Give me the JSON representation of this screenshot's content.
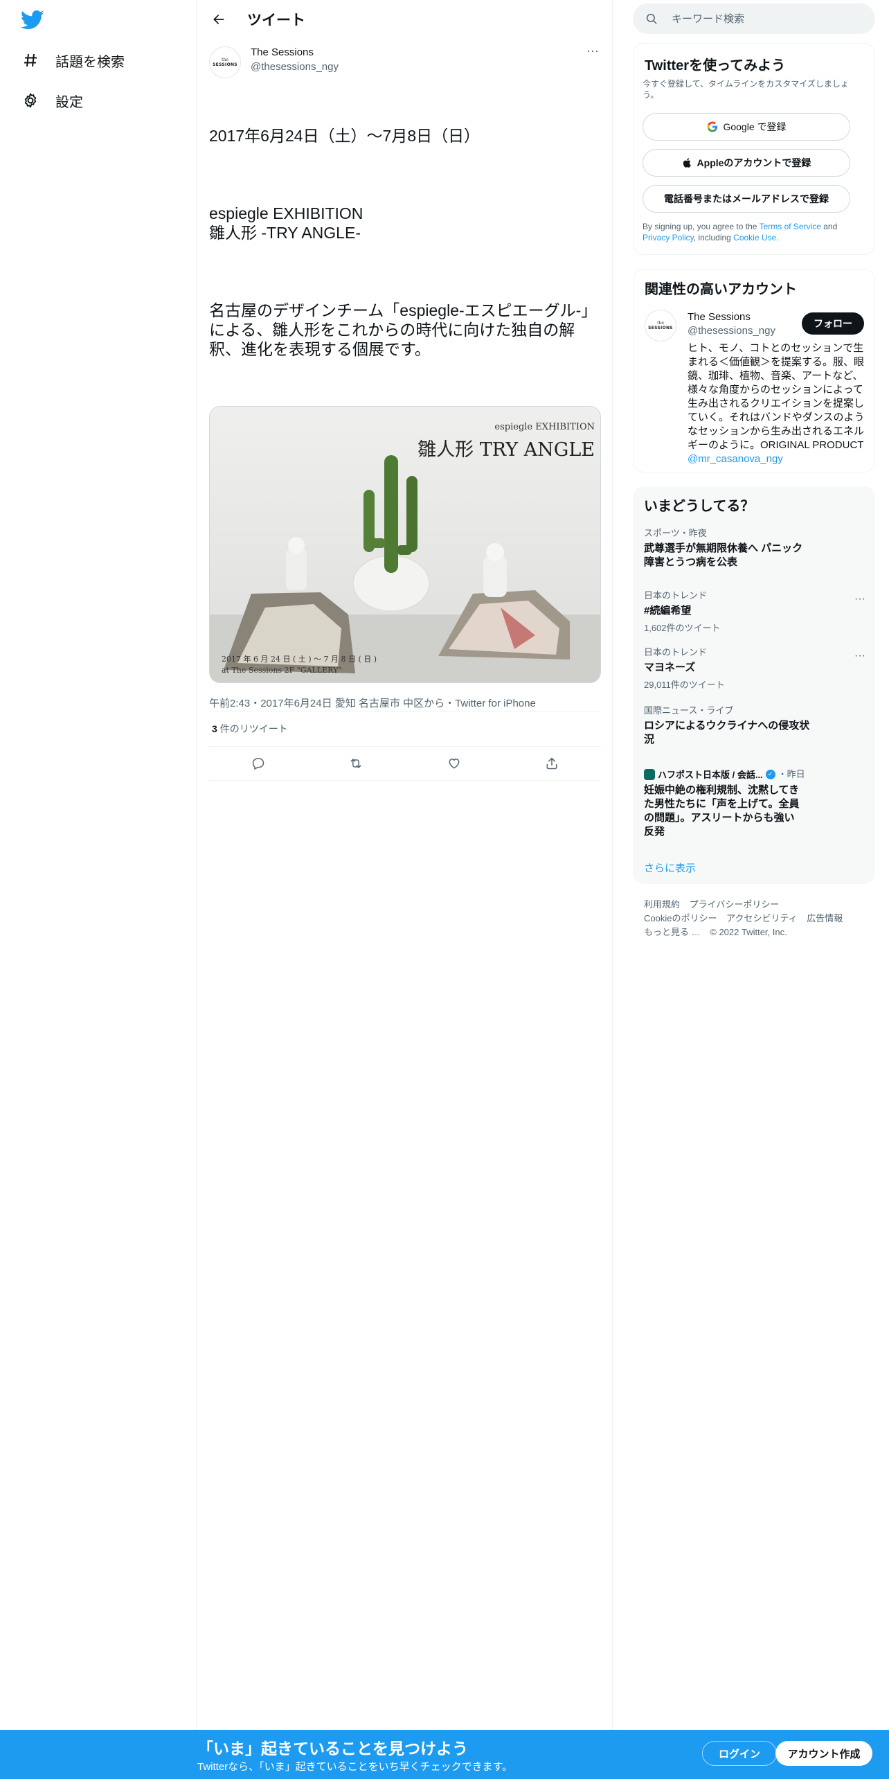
{
  "nav": {
    "items": [
      {
        "label": "話題を検索",
        "icon": "hashtag-icon"
      },
      {
        "label": "設定",
        "icon": "gear-icon"
      }
    ]
  },
  "header": {
    "title": "ツイート"
  },
  "tweet": {
    "author_name": "The Sessions",
    "author_handle": "@thesessions_ngy",
    "avatar_top": "the",
    "avatar_name": "SESSIONS",
    "paragraphs": [
      "2017年6月24日（土）～7月8日（日）",
      "espiegle EXHIBITION\n雛人形 -TRY ANGLE-",
      "名古屋のデザインチーム「espiegle-エスピエーグル-」による、雛人形をこれからの時代に向けた独自の解釈、進化を表現する個展です。"
    ],
    "image_text": {
      "top_small": "espiegle EXHIBITION",
      "top_big": "雛人形 TRY ANGLE",
      "bottom1": "2017 年 6 月 24 日 ( 土 ) ～ 7 月 8 日 ( 日 )",
      "bottom2": "at The Sessions 2F \"GALLERY\""
    },
    "meta": "午前2:43・2017年6月24日 愛知 名古屋市 中区から・Twitter for iPhone",
    "retweet_count": "3",
    "retweet_label": "件のリツイート"
  },
  "search": {
    "placeholder": "キーワード検索"
  },
  "signup_card": {
    "title": "Twitterを使ってみよう",
    "subtitle": "今すぐ登録して、タイムラインをカスタマイズしましょう。",
    "google_label": "Google で登録",
    "apple_label": "Appleのアカウントで登録",
    "phone_label": "電話番号またはメールアドレスで登録",
    "legal_prefix": "By signing up, you agree to the ",
    "terms": "Terms of Service",
    "and": " and ",
    "privacy": "Privacy Policy",
    "including": ", including ",
    "cookie": "Cookie Use",
    "period": "."
  },
  "related": {
    "title": "関連性の高いアカウント",
    "name": "The Sessions",
    "handle": "@thesessions_ngy",
    "follow_label": "フォロー",
    "bio": "ヒト、モノ、コトとのセッションで生まれる＜価値観＞を提案する。服、眼鏡、珈琲、植物、音楽、アートなど、様々な角度からのセッションによって生み出されるクリエイションを提案していく。それはバンドやダンスのようなセッションから生み出されるエネルギーのように。ORIGINAL PRODUCT ",
    "bio_link": "@mr_casanova_ngy"
  },
  "trends": {
    "title": "いまどうしてる？",
    "items": [
      {
        "category": "スポーツ・昨夜",
        "title": "武尊選手が無期限休養へ パニック障害とうつ病を公表"
      },
      {
        "category": "日本のトレンド",
        "title": "#続編希望",
        "count": "1,602件のツイート"
      },
      {
        "category": "日本のトレンド",
        "title": "マヨネーズ",
        "count": "29,011件のツイート"
      },
      {
        "category": "国際ニュース・ライブ",
        "title": "ロシアによるウクライナへの侵攻状況"
      },
      {
        "source": "ハフポスト日本版 / 会話...",
        "time": "・昨日",
        "title": "妊娠中絶の権利規制、沈黙してきた男性たちに「声を上げて。全員の問題」。アスリートからも強い反発"
      }
    ],
    "show_more": "さらに表示"
  },
  "footer": {
    "links": [
      "利用規約",
      "プライバシーポリシー",
      "Cookieのポリシー",
      "アクセシビリティ",
      "広告情報",
      "もっと見る …"
    ],
    "copyright": "© 2022 Twitter, Inc."
  },
  "bottom_bar": {
    "title": "「いま」起きていることを見つけよう",
    "subtitle": "Twitterなら、「いま」起きていることをいち早くチェックできます。",
    "login": "ログイン",
    "signup": "アカウント作成"
  },
  "colors": {
    "accent": "#1d9bf0",
    "text": "#0f1419",
    "secondary": "#536471",
    "banner": "#1d9bf0"
  }
}
